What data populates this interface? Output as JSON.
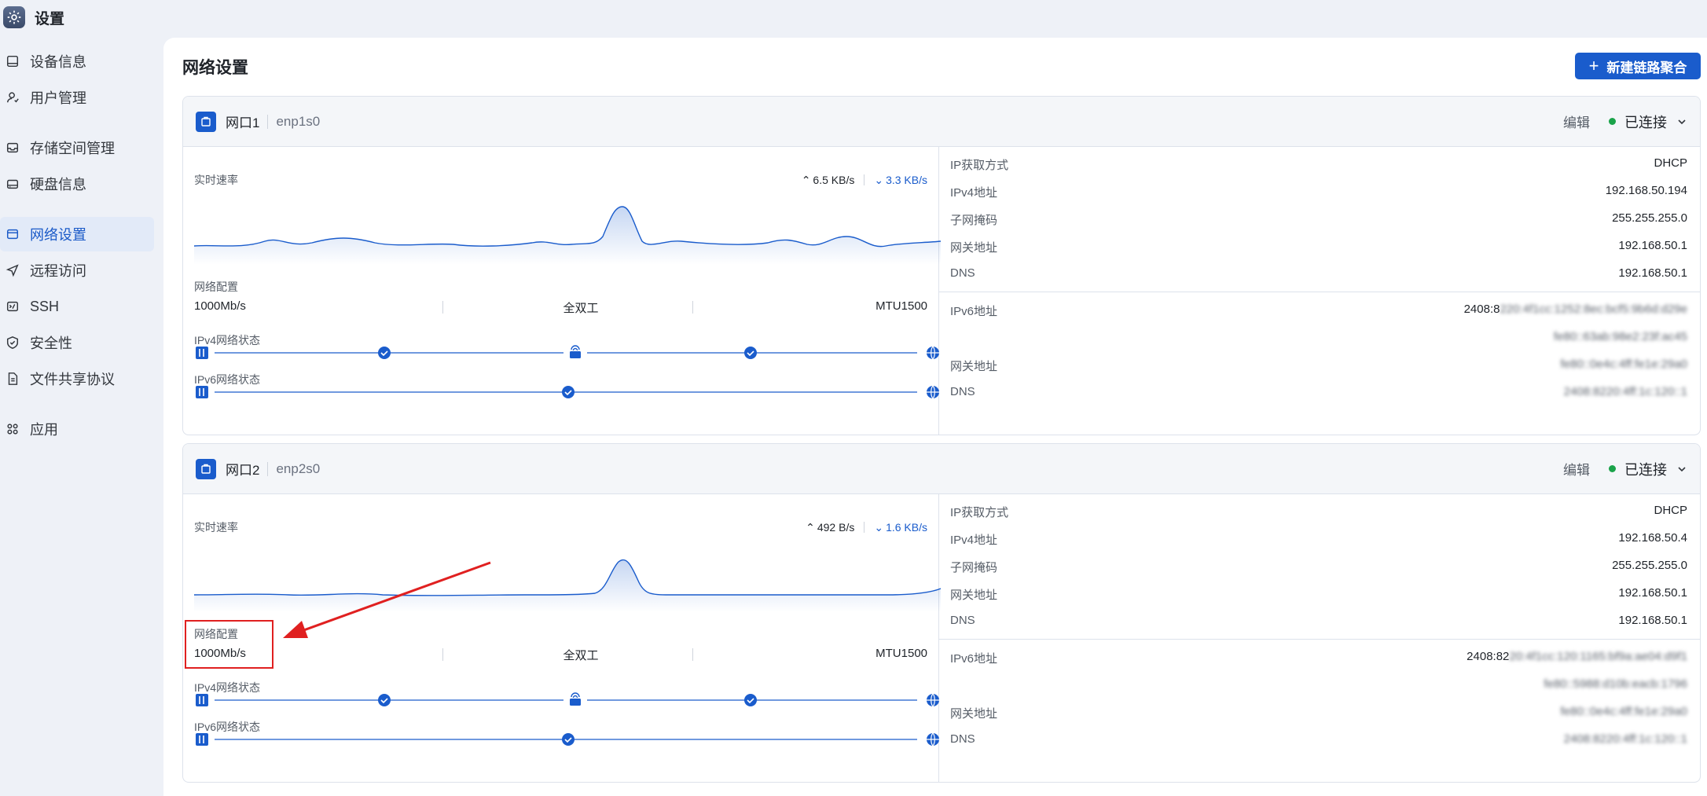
{
  "app": {
    "title": "设置",
    "icon": "gear-icon"
  },
  "sidebar": {
    "items": [
      {
        "label": "设备信息",
        "icon": "device-icon",
        "active": false
      },
      {
        "label": "用户管理",
        "icon": "user-icon",
        "active": false
      },
      {
        "label": "存储空间管理",
        "icon": "storage-icon",
        "active": false
      },
      {
        "label": "硬盘信息",
        "icon": "disk-icon",
        "active": false
      },
      {
        "label": "网络设置",
        "icon": "network-icon",
        "active": true
      },
      {
        "label": "远程访问",
        "icon": "remote-icon",
        "active": false
      },
      {
        "label": "SSH",
        "icon": "ssh-icon",
        "active": false
      },
      {
        "label": "安全性",
        "icon": "shield-icon",
        "active": false
      },
      {
        "label": "文件共享协议",
        "icon": "file-share-icon",
        "active": false
      },
      {
        "label": "应用",
        "icon": "apps-icon",
        "active": false
      }
    ]
  },
  "main": {
    "title": "网络设置",
    "new_button": "新建链路聚合"
  },
  "labels": {
    "edit": "编辑",
    "rate": "实时速率",
    "config": "网络配置",
    "ipv4_status": "IPv4网络状态",
    "ipv6_status": "IPv6网络状态"
  },
  "ports": [
    {
      "name": "网口1",
      "iface": "enp1s0",
      "status": "已连接",
      "up_rate": "6.5 KB/s",
      "down_rate": "3.3 KB/s",
      "speed": "1000Mb/s",
      "duplex": "全双工",
      "mtu": "MTU1500",
      "ipv4": [
        {
          "key": "IP获取方式",
          "value": "DHCP"
        },
        {
          "key": "IPv4地址",
          "value": "192.168.50.194"
        },
        {
          "key": "子网掩码",
          "value": "255.255.255.0"
        },
        {
          "key": "网关地址",
          "value": "192.168.50.1"
        },
        {
          "key": "DNS",
          "value": "192.168.50.1"
        }
      ],
      "ipv6": {
        "addr_key": "IPv6地址",
        "addr_visible": "2408:8",
        "addr_blurred": "220:4f1cc:1252:8ec:bcf5:9b6d:d29e",
        "addr_line2": "fe80::63ab:98e2:23f:ac45",
        "gw_key": "网关地址",
        "gw_value": "fe80::0e4c:4ff:fe1e:29a0",
        "dns_key": "DNS",
        "dns_value": "2408:8220:4ff:1c:120::1"
      }
    },
    {
      "name": "网口2",
      "iface": "enp2s0",
      "status": "已连接",
      "up_rate": "492 B/s",
      "down_rate": "1.6 KB/s",
      "speed": "1000Mb/s",
      "duplex": "全双工",
      "mtu": "MTU1500",
      "ipv4": [
        {
          "key": "IP获取方式",
          "value": "DHCP"
        },
        {
          "key": "IPv4地址",
          "value": "192.168.50.4"
        },
        {
          "key": "子网掩码",
          "value": "255.255.255.0"
        },
        {
          "key": "网关地址",
          "value": "192.168.50.1"
        },
        {
          "key": "DNS",
          "value": "192.168.50.1"
        }
      ],
      "ipv6": {
        "addr_key": "IPv6地址",
        "addr_visible": "2408:82",
        "addr_blurred": "20:4f1cc:120:1165:bf9a:ae04:d9f1",
        "addr_line2": "fe80::5988:d10b:eacb:1796",
        "gw_key": "网关地址",
        "gw_value": "fe80::0e4c:4ff:fe1e:29a0",
        "dns_key": "DNS",
        "dns_value": "2408:8220:4ff:1c:120::1"
      }
    }
  ],
  "colors": {
    "accent": "#1a5ccc",
    "connected": "#1aa34a",
    "annotation": "#e02020"
  }
}
